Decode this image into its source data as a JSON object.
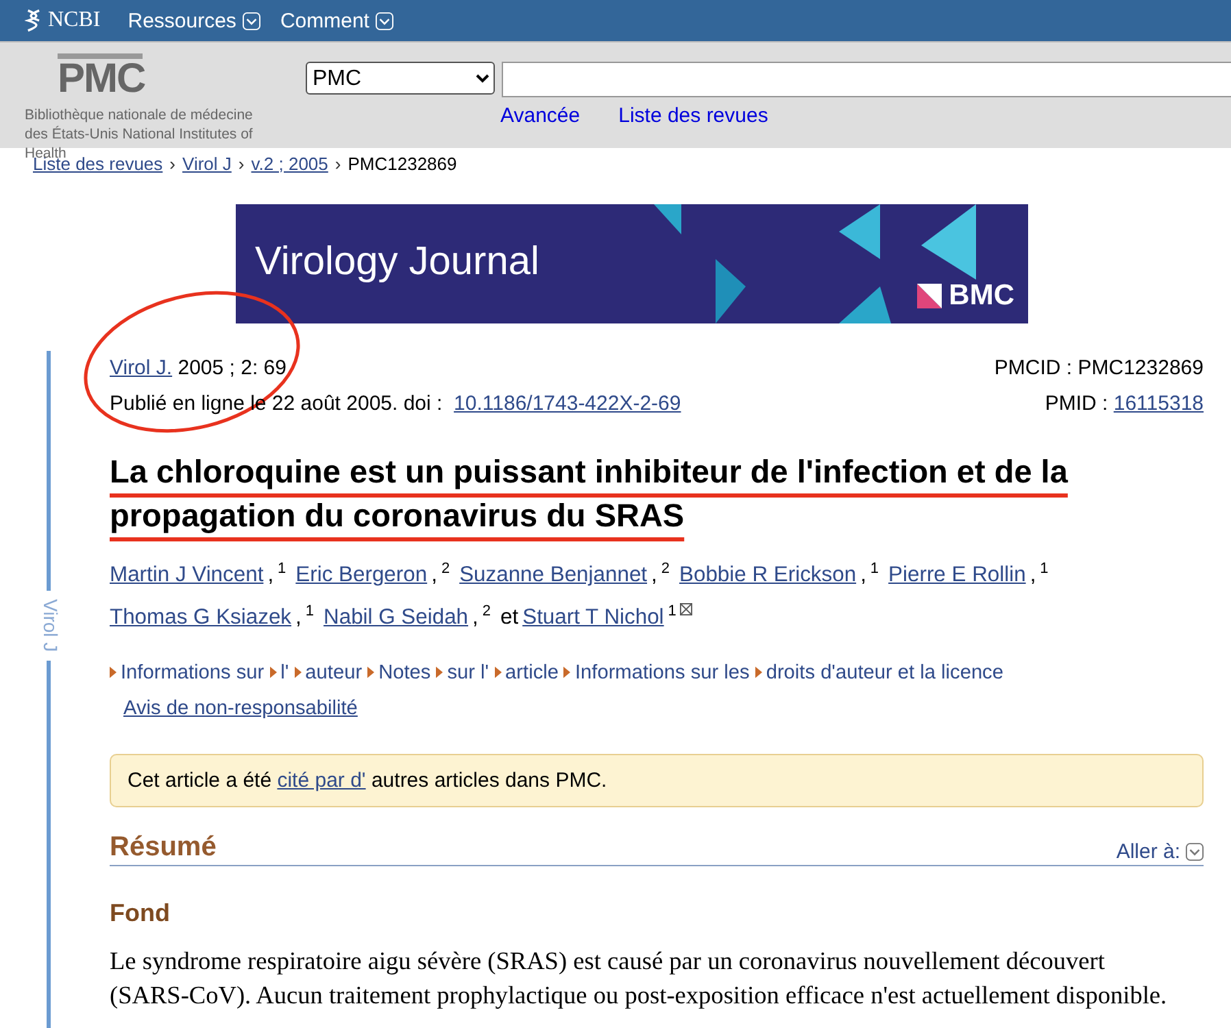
{
  "topbar": {
    "logo": "NCBI",
    "menus": [
      {
        "label": "Ressources"
      },
      {
        "label": "Comment"
      }
    ]
  },
  "header": {
    "logo": "PMC",
    "caption": "Bibliothèque nationale de médecine des États-Unis National Institutes of Health",
    "database": "PMC",
    "links": [
      "Avancée",
      "Liste des revues"
    ]
  },
  "breadcrumb": [
    {
      "label": "Liste des revues",
      "link": true
    },
    {
      "sep": "›",
      "label": "Virol J",
      "link": true
    },
    {
      "sep": "›",
      "label": "v.2 ; 2005",
      "link": true
    },
    {
      "sep": "›",
      "label": "PMC1232869",
      "link": false
    }
  ],
  "banner": {
    "title": "Virology Journal",
    "publisher": "BMC"
  },
  "sidebar_label": "Virol J",
  "citation": {
    "journal": "Virol J.",
    "issue": "2005 ; 2: 69",
    "published": "Publié en ligne le 22 août 2005. doi :",
    "doi": "10.1186/1743-422X-2-69",
    "pmcid": "PMCID : PMC1232869",
    "pmid_label": "PMID :",
    "pmid": "16115318"
  },
  "title": "La chloroquine est un puissant inhibiteur de l'infection et de la propagation du coronavirus du SRAS",
  "authors": [
    {
      "name": "Martin J Vincent",
      "sep": ",",
      "aff": "1",
      "contact": false
    },
    {
      "name": "Eric Bergeron",
      "sep": ",",
      "aff": "2",
      "contact": false
    },
    {
      "name": "Suzanne Benjannet",
      "sep": ",",
      "aff": "2",
      "contact": false
    },
    {
      "name": "Bobbie R Erickson",
      "sep": ",",
      "aff": "1",
      "contact": false
    },
    {
      "name": "Pierre E Rollin",
      "sep": ",",
      "aff": "1",
      "contact": false
    },
    {
      "name": "Thomas G Ksiazek",
      "sep": ",",
      "aff": "1",
      "contact": false
    },
    {
      "name": "Nabil G Seidah",
      "sep": ",",
      "aff": "2",
      "contact": false
    },
    {
      "prefix": "et",
      "name": "Stuart T Nichol",
      "aff": "1",
      "contact": true
    }
  ],
  "article_links": [
    {
      "label": "Informations sur",
      "kind": "toggle"
    },
    {
      "label": "l'",
      "kind": "toggle"
    },
    {
      "label": "auteur",
      "kind": "toggle"
    },
    {
      "label": "Notes",
      "kind": "toggle"
    },
    {
      "label": "sur l'",
      "kind": "toggle"
    },
    {
      "label": "article",
      "kind": "toggle"
    },
    {
      "label": "Informations sur les",
      "kind": "toggle"
    },
    {
      "label": "droits d'auteur et la licence",
      "kind": "toggle"
    },
    {
      "label": "Avis de non-responsabilité",
      "kind": "link"
    }
  ],
  "notice": {
    "before": "Cet article a été",
    "link": "cité par d'",
    "after": "autres articles dans PMC."
  },
  "section": {
    "heading": "Résumé",
    "jump": "Aller à:"
  },
  "subsection": {
    "heading": "Fond",
    "text": "Le syndrome respiratoire aigu sévère (SRAS) est causé par un coronavirus nouvellement découvert (SARS-CoV). Aucun traitement prophylactique ou post-exposition efficace n'est actuellement disponible."
  }
}
